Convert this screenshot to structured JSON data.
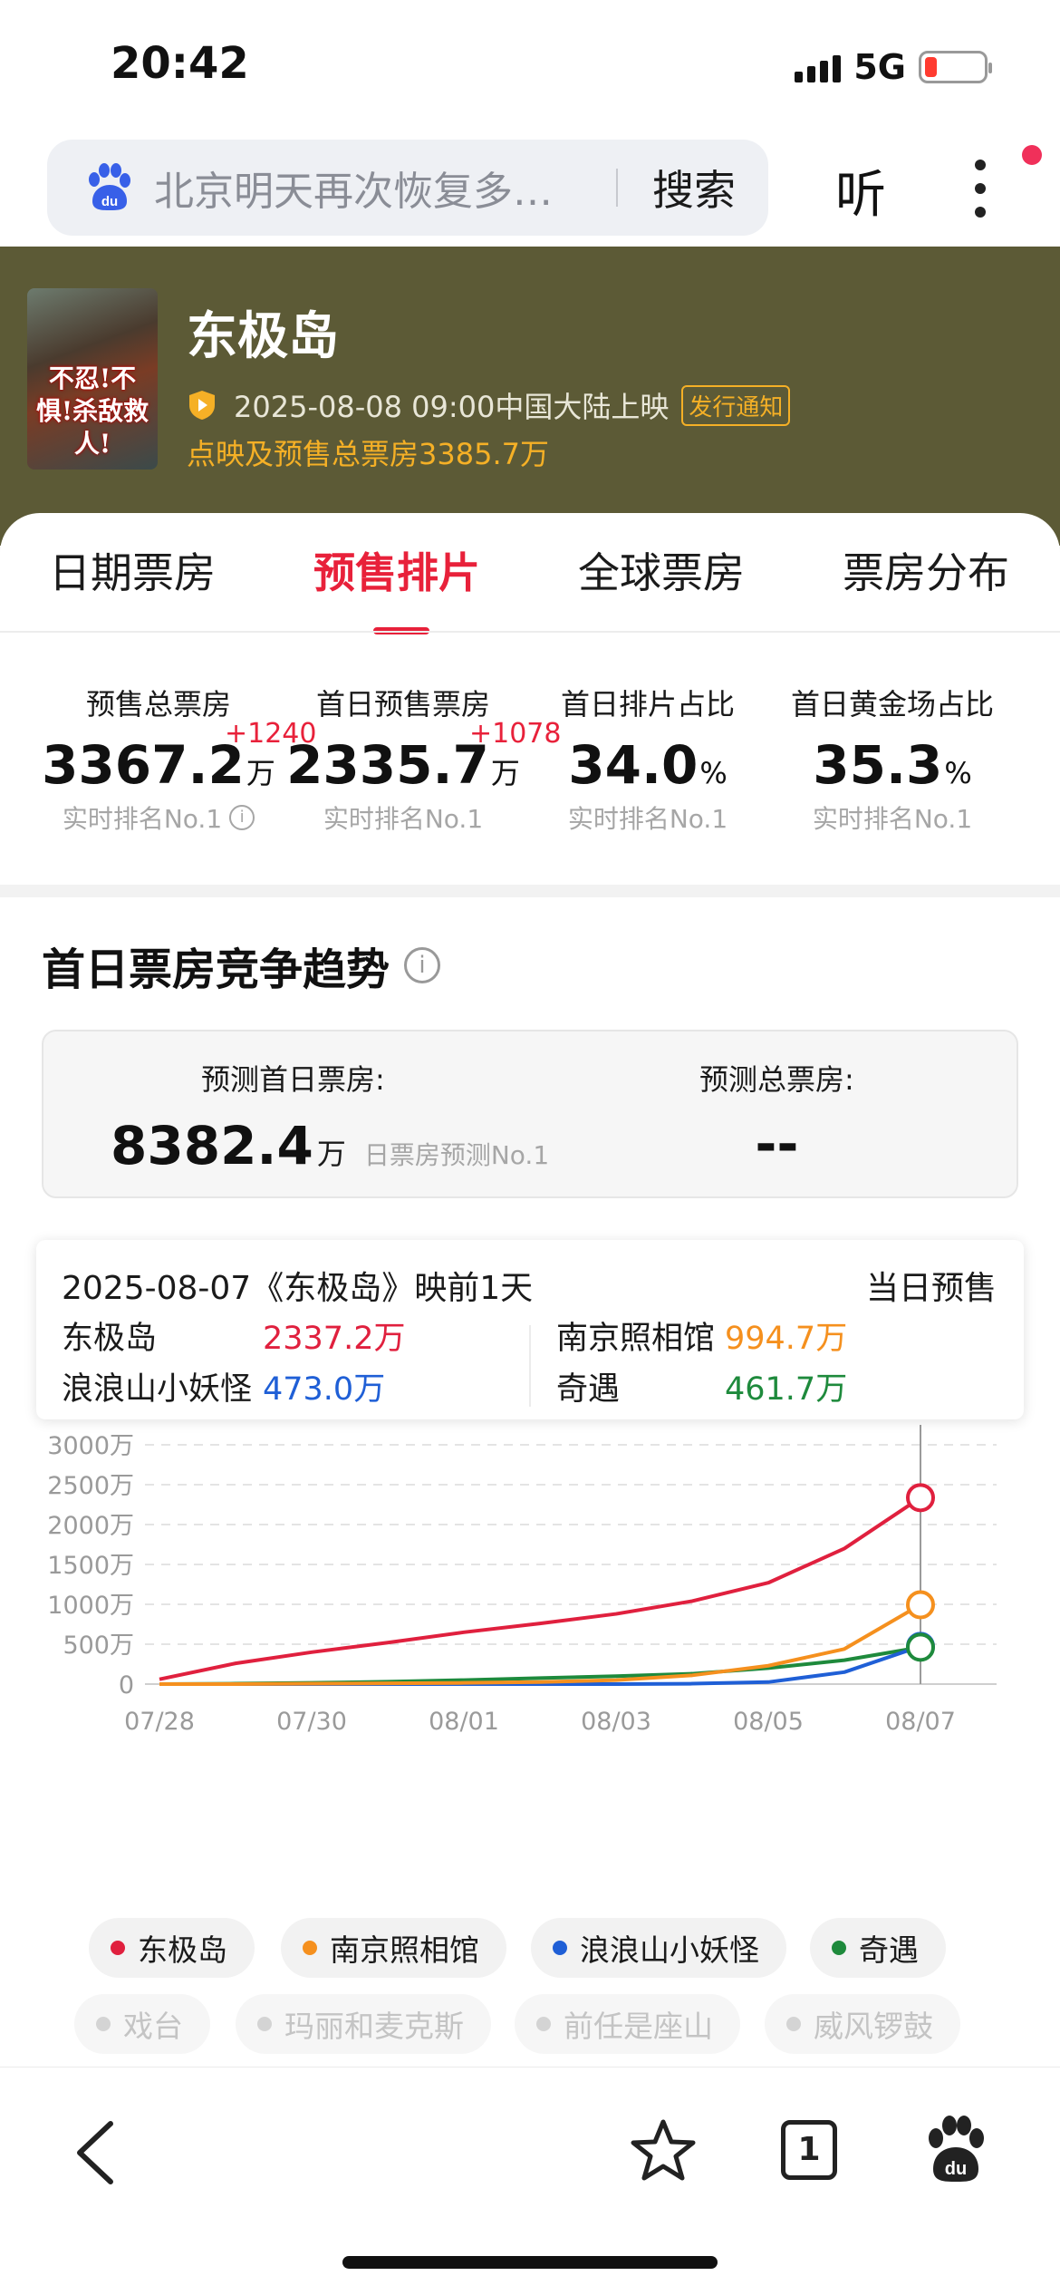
{
  "status_bar": {
    "time": "20:42",
    "network": "5G",
    "battery_level": 0.2
  },
  "search": {
    "query": "北京明天再次恢复多…",
    "button": "搜索"
  },
  "header_actions": {
    "listen": "听"
  },
  "movie": {
    "poster_text": "不忍!不惧!杀敌救人!",
    "title": "东极岛",
    "release": "2025-08-08 09:00中国大陆上映",
    "notice": "发行通知",
    "presale_total": "点映及预售总票房3385.7万"
  },
  "tabs": [
    "日期票房",
    "预售排片",
    "全球票房",
    "票房分布"
  ],
  "active_tab": 1,
  "stats": [
    {
      "label": "预售总票房",
      "value": "3367.2",
      "unit": "万",
      "delta": "+1240",
      "rank": "实时排名No.1"
    },
    {
      "label": "首日预售票房",
      "value": "2335.7",
      "unit": "万",
      "delta": "+1078",
      "rank": "实时排名No.1"
    },
    {
      "label": "首日排片占比",
      "value": "34.0",
      "unit": "%",
      "rank": "实时排名No.1"
    },
    {
      "label": "首日黄金场占比",
      "value": "35.3",
      "unit": "%",
      "rank": "实时排名No.1"
    }
  ],
  "trend": {
    "title": "首日票房竞争趋势",
    "forecast_first_day_label": "预测首日票房:",
    "forecast_first_day_value": "8382.4",
    "forecast_first_day_unit": "万",
    "forecast_first_day_rank": "日票房预测No.1",
    "forecast_total_label": "预测总票房:",
    "forecast_total_value": "--"
  },
  "tooltip": {
    "date": "2025-08-07《东极岛》映前1天",
    "type": "当日预售",
    "items": [
      {
        "name": "东极岛",
        "value": "2337.2万"
      },
      {
        "name": "南京照相馆",
        "value": "994.7万"
      },
      {
        "name": "浪浪山小妖怪",
        "value": "473.0万"
      },
      {
        "name": "奇遇",
        "value": "461.7万"
      }
    ]
  },
  "chart_data": {
    "type": "line",
    "x": [
      "07/28",
      "07/29",
      "07/30",
      "07/31",
      "08/01",
      "08/02",
      "08/03",
      "08/04",
      "08/05",
      "08/06",
      "08/07"
    ],
    "x_tick_labels": [
      "07/28",
      "07/30",
      "08/01",
      "08/03",
      "08/05",
      "08/07"
    ],
    "y_ticks": [
      "0",
      "500万",
      "1000万",
      "1500万",
      "2000万",
      "2500万",
      "3000万"
    ],
    "ylim": [
      0,
      3000
    ],
    "grid": true,
    "series": [
      {
        "name": "东极岛",
        "color": "#e0203e",
        "values": [
          60,
          260,
          400,
          520,
          650,
          760,
          880,
          1040,
          1270,
          1700,
          2337.2
        ]
      },
      {
        "name": "南京照相馆",
        "color": "#f5901e",
        "values": [
          0,
          0,
          5,
          10,
          15,
          25,
          50,
          110,
          230,
          440,
          994.7
        ]
      },
      {
        "name": "浪浪山小妖怪",
        "color": "#1f5fd6",
        "values": [
          0,
          0,
          0,
          0,
          0,
          0,
          0,
          5,
          25,
          150,
          473.0
        ]
      },
      {
        "name": "奇遇",
        "color": "#1e8a3c",
        "values": [
          0,
          5,
          15,
          30,
          50,
          75,
          100,
          130,
          200,
          300,
          461.7
        ]
      }
    ],
    "inactive_series": [
      "戏台",
      "玛丽和麦克斯",
      "前任是座山",
      "威风锣鼓"
    ],
    "highlight_index": 10
  }
}
